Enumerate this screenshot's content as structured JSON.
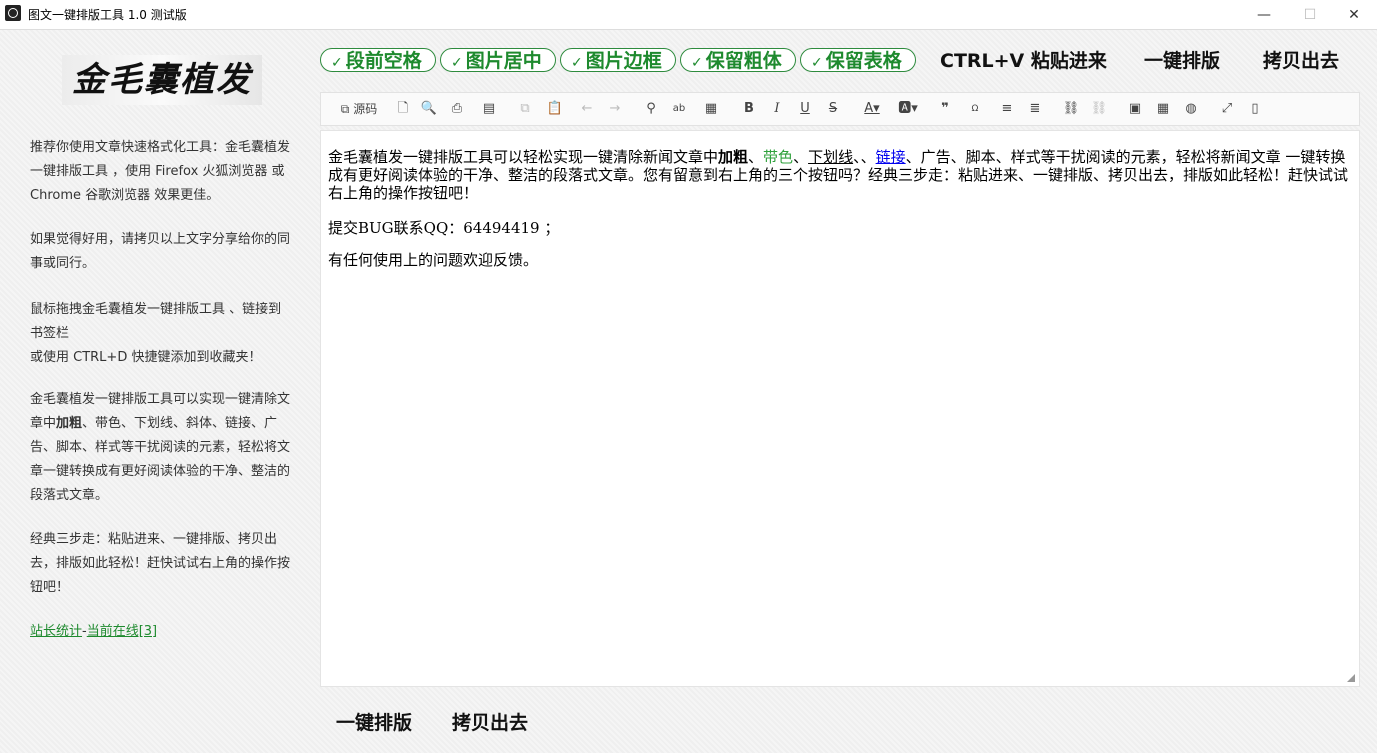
{
  "window": {
    "title": "图文一键排版工具 1.0 测试版",
    "minimize": "—",
    "maximize": "☐",
    "close": "✕"
  },
  "sidebar": {
    "logo_text": "金毛囊植发",
    "p1": "推荐你使用文章快速格式化工具：金毛囊植发一键排版工具 ，使用 Firefox 火狐浏览器 或 Chrome 谷歌浏览器 效果更佳。",
    "p2": "如果觉得好用，请拷贝以上文字分享给你的同事或同行。",
    "p3a": "鼠标拖拽金毛囊植发一键排版工具 、链接到书签栏",
    "p3b": "或使用 CTRL+D 快捷键添加到收藏夹！",
    "p4a": "金毛囊植发一键排版工具可以实现一键清除文章中",
    "p4b": "加粗",
    "p4c": "、带色、下划线、斜体、链接、广告、脚本、样式等干扰阅读的元素，轻松将文章一键转换成有更好阅读体验的干净、整洁的段落式文章。",
    "p5": "经典三步走：粘贴进来、一键排版、拷贝出去，排版如此轻松！赶快试试右上角的操作按钮吧！",
    "stats_link": "站长统计",
    "sep": "-",
    "online_link": "当前在线[3]"
  },
  "options": [
    {
      "check": "✓",
      "label": "段前空格"
    },
    {
      "check": "✓",
      "label": "图片居中"
    },
    {
      "check": "✓",
      "label": "图片边框"
    },
    {
      "check": "✓",
      "label": "保留粗体"
    },
    {
      "check": "✓",
      "label": "保留表格"
    }
  ],
  "actions": {
    "paste": "CTRL+V 粘贴进来",
    "format": "一键排版",
    "copy": "拷贝出去"
  },
  "toolbar": {
    "source_icon": "source-code-icon",
    "source_label": "源码",
    "icons": [
      "new-doc-icon",
      "preview-icon",
      "print-icon",
      "template-icon",
      "cut-icon",
      "paste-icon",
      "undo-icon",
      "redo-icon",
      "find-icon",
      "replace-icon",
      "format-painter-icon",
      "bold-icon",
      "italic-icon",
      "underline-icon",
      "strikethrough-icon",
      "font-color-icon",
      "bg-color-icon",
      "quote-icon",
      "special-char-icon",
      "align-left-icon",
      "align-right-icon",
      "link-icon",
      "unlink-icon",
      "image-icon",
      "table-icon",
      "globe-icon",
      "fullscreen-icon",
      "mobile-icon"
    ]
  },
  "editor": {
    "l1a": "金毛囊植发一键排版工具可以轻松实现一键清除新闻文章中",
    "l1b": "加粗",
    "l1c": "、",
    "l1d": "带色",
    "l1e": "、",
    "l1f": "下划线",
    "l1g": "、、",
    "l1h": "链接",
    "l1i": "、广告、脚本、样式等干扰阅读的元素，轻松将新闻文章 一键转换成有更好阅读体验的干净、整洁的段落式文章。您有留意到右上角的三个按钮吗？经典三步走：粘贴进来、一键排版、拷贝出去，排版如此轻松！赶快试试 右上角的操作按钮吧！",
    "p2": "提交BUG联系QQ：64494419 ；",
    "p3": "有任何使用上的问题欢迎反馈。"
  },
  "bottom": {
    "format": "一键排版",
    "copy": "拷贝出去"
  },
  "colors": {
    "accent_green": "#1e8a2e",
    "link_blue": "#0000ee"
  }
}
